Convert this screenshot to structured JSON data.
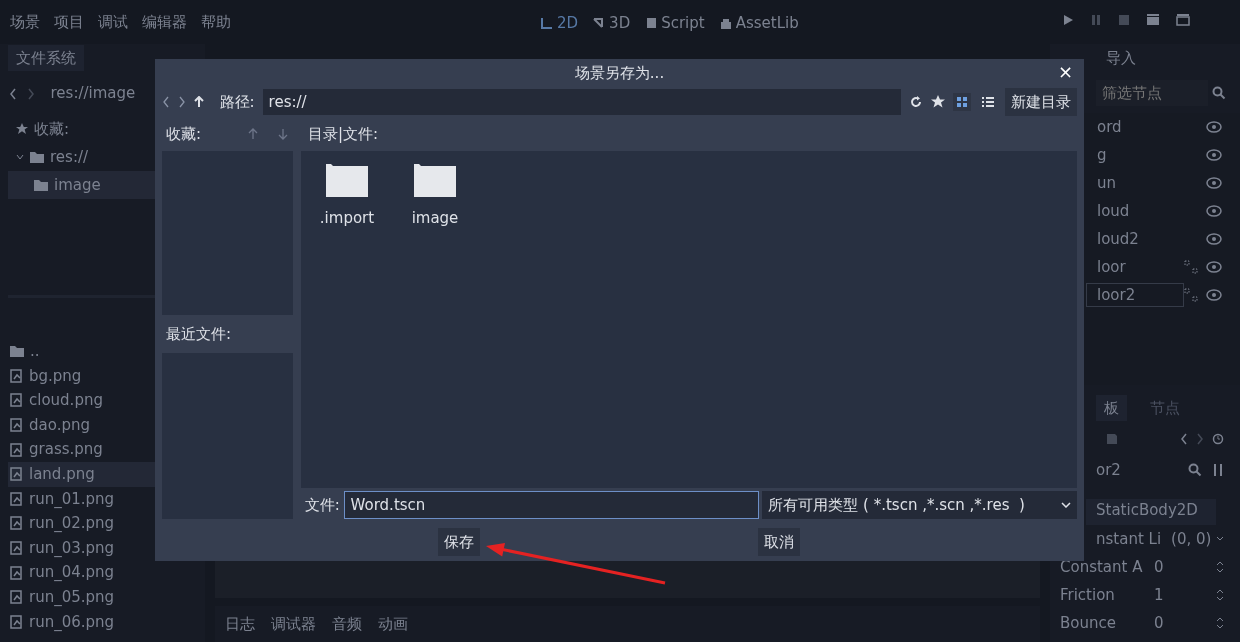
{
  "menu": [
    "场景",
    "项目",
    "调试",
    "编辑器",
    "帮助"
  ],
  "workspaces": [
    {
      "label": "2D",
      "kind": "twod",
      "selected": true
    },
    {
      "label": "3D",
      "kind": "threed",
      "selected": false
    },
    {
      "label": "Script",
      "kind": "script",
      "selected": false
    },
    {
      "label": "AssetLib",
      "kind": "assetlib",
      "selected": false
    }
  ],
  "filesystem": {
    "tab": "文件系统",
    "path": "res://image",
    "tree": [
      {
        "label": "收藏:",
        "kind": "favorites",
        "selected": false
      },
      {
        "label": "res://",
        "kind": "folder",
        "expanded": true,
        "selected": false,
        "children": [
          {
            "label": "image",
            "kind": "folder",
            "selected": true
          }
        ]
      }
    ],
    "files": [
      {
        "name": "..",
        "kind": "folder",
        "selected": false
      },
      {
        "name": "bg.png",
        "kind": "image",
        "selected": false
      },
      {
        "name": "cloud.png",
        "kind": "image",
        "selected": false
      },
      {
        "name": "dao.png",
        "kind": "image",
        "selected": false
      },
      {
        "name": "grass.png",
        "kind": "image",
        "selected": false
      },
      {
        "name": "land.png",
        "kind": "image",
        "selected": true
      },
      {
        "name": "run_01.png",
        "kind": "image",
        "selected": false
      },
      {
        "name": "run_02.png",
        "kind": "image",
        "selected": false
      },
      {
        "name": "run_03.png",
        "kind": "image",
        "selected": false
      },
      {
        "name": "run_04.png",
        "kind": "image",
        "selected": false
      },
      {
        "name": "run_05.png",
        "kind": "image",
        "selected": false
      },
      {
        "name": "run_06.png",
        "kind": "image",
        "selected": false
      }
    ]
  },
  "scene_dock": {
    "tab": "导入",
    "filter": {
      "placeholder": "筛选节点"
    },
    "nodes": [
      {
        "name": "ord",
        "grouped": false,
        "selected": false
      },
      {
        "name": "g",
        "grouped": false,
        "selected": false
      },
      {
        "name": "un",
        "grouped": false,
        "selected": false
      },
      {
        "name": "loud",
        "grouped": false,
        "selected": false
      },
      {
        "name": "loud2",
        "grouped": false,
        "selected": false
      },
      {
        "name": "loor",
        "grouped": true,
        "selected": false
      },
      {
        "name": "loor2",
        "grouped": true,
        "selected": true
      }
    ]
  },
  "inspector": {
    "tabs": [
      {
        "label": "板",
        "selected": true
      },
      {
        "label": "节点",
        "selected": false
      }
    ],
    "object": "or2",
    "class": "StaticBody2D",
    "properties": [
      {
        "name": "nstant Li",
        "value": "(0, 0)",
        "kind": "dropdown"
      },
      {
        "name": "Constant A",
        "value": "0",
        "kind": "spin"
      },
      {
        "name": "Friction",
        "value": "1",
        "kind": "spin"
      },
      {
        "name": "Bounce",
        "value": "0",
        "kind": "spin"
      }
    ]
  },
  "bottom_tabs": [
    "日志",
    "调试器",
    "音频",
    "动画"
  ],
  "dialog": {
    "title": "场景另存为...",
    "close": "×",
    "path_label": "路径:",
    "path": "res://",
    "views": [
      {
        "kind": "grid",
        "selected": true
      },
      {
        "kind": "list",
        "selected": false
      }
    ],
    "new_folder": "新建目录",
    "favorites_label": "收藏:",
    "recent_label": "最近文件:",
    "files_label": "目录|文件:",
    "items": [
      {
        "name": ".import"
      },
      {
        "name": "image"
      }
    ],
    "file_label": "文件:",
    "file_value": "Word.tscn",
    "filter": "所有可用类型 ( *.tscn ,*.scn ,*.res  )",
    "buttons": [
      {
        "label": "保存"
      },
      {
        "label": "取消"
      }
    ]
  }
}
